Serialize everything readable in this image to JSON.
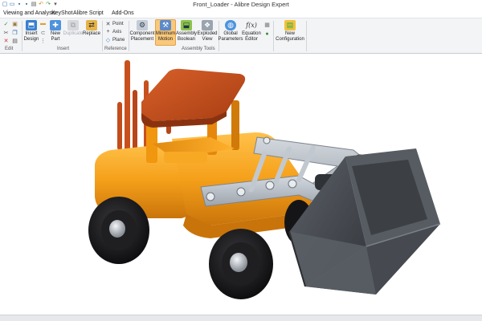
{
  "window": {
    "title": "Front_Loader - Alibre Design Expert"
  },
  "quick_access": {
    "icons": [
      {
        "name": "new-file-icon",
        "glyph": "▢"
      },
      {
        "name": "open-folder-icon",
        "glyph": "▭"
      },
      {
        "name": "save-icon",
        "glyph": "▪"
      },
      {
        "name": "save-all-icon",
        "glyph": "▪"
      },
      {
        "name": "print-icon",
        "glyph": "▤"
      },
      {
        "name": "undo-icon",
        "glyph": "↶"
      },
      {
        "name": "redo-icon",
        "glyph": "↷"
      },
      {
        "name": "customize-dropdown-icon",
        "glyph": "▾"
      }
    ]
  },
  "menu": {
    "items": [
      "Viewing and Analysis",
      "KeyShot",
      "Alibre Script",
      "Add-Ons"
    ]
  },
  "ribbon": {
    "groups": {
      "edit": "Edit",
      "insert": "Insert",
      "reference": "Reference",
      "assembly_tools": "Assembly Tools"
    },
    "buttons": {
      "insert_design": "Insert\nDesign",
      "new_part": "New\nPart",
      "duplicate": "Duplicate",
      "replace": "Replace",
      "point": "Point",
      "axis": "Axis",
      "plane": "Plane",
      "component_placement": "Component\nPlacement",
      "minimum_motion": "Minimum\nMotion",
      "assembly_boolean": "Assembly\nBoolean",
      "exploded_view": "Exploded\nView",
      "global_parameters": "Global\nParameters",
      "equation_editor": "Equation\nEditor",
      "new_configuration": "New\nConfiguration"
    },
    "icon_glyphs": {
      "fx": "f(x)"
    }
  },
  "colors": {
    "ribbon_bg": "#f3f4f6",
    "active_button": "#f9c87a",
    "body_orange": "#f5a01a",
    "cab_roof": "#c8501e",
    "bucket_gray": "#4a4e54",
    "arm_gray": "#b8bec6",
    "tire_black": "#1c1c1e"
  }
}
